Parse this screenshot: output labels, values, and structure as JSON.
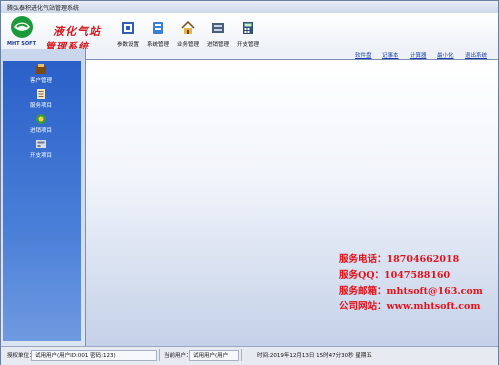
{
  "window": {
    "title": "腾弘泰积进化气站管理系统"
  },
  "brand": {
    "logo_text": "MHT SOFT",
    "slogan_line1": "液化气站",
    "slogan_line2": "管理系统"
  },
  "toolbar": [
    {
      "label": "参数设置",
      "icon": "settings-icon"
    },
    {
      "label": "系统管理",
      "icon": "system-icon"
    },
    {
      "label": "业务管理",
      "icon": "home-icon"
    },
    {
      "label": "进销管理",
      "icon": "inventory-icon"
    },
    {
      "label": "开支管理",
      "icon": "calculator-icon"
    }
  ],
  "quick_links": [
    "软件盘",
    "记事本",
    "计算器",
    "最小化",
    "退出系统"
  ],
  "sidebar": [
    {
      "label": "客户管理",
      "icon": "customer-icon"
    },
    {
      "label": "服务项目",
      "icon": "service-icon"
    },
    {
      "label": "进销项目",
      "icon": "sales-icon"
    },
    {
      "label": "开支项目",
      "icon": "expense-icon"
    }
  ],
  "contact": {
    "phone": "服务电话：18704662018",
    "qq": "服务QQ：1047588160",
    "email": "服务邮箱：mhtsoft@163.com",
    "website": "公司网站：www.mhtsoft.com"
  },
  "status": {
    "auth_label": "授权单位：",
    "auth_value": "试用用户(用户ID:001 密码:123)",
    "user_label": "当前用户：",
    "user_value": "试用用户(用户",
    "time_value": "时间:2019年12月13日 15时47分30秒 星期五"
  },
  "colors": {
    "brand_red": "#d2191e",
    "sidebar_blue": "#2a60c8",
    "link_blue": "#1b3fa8"
  }
}
